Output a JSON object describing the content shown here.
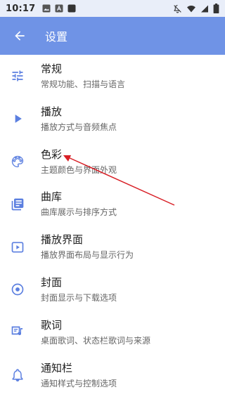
{
  "status_bar": {
    "time": "10:17",
    "notification_icons": [
      "image-icon",
      "text-icon",
      "app-icon"
    ],
    "system_icons": [
      "mute-icon",
      "wifi-icon",
      "signal-icon",
      "battery-icon"
    ]
  },
  "app_bar": {
    "title": "设置",
    "background": "#6f93e6"
  },
  "settings": [
    {
      "title": "常规",
      "subtitle": "常规功能、扫描与语言",
      "icon": "tune-icon"
    },
    {
      "title": "播放",
      "subtitle": "播放方式与音频焦点",
      "icon": "play-icon"
    },
    {
      "title": "色彩",
      "subtitle": "主题颜色与界面外观",
      "icon": "palette-icon"
    },
    {
      "title": "曲库",
      "subtitle": "曲库展示与排序方式",
      "icon": "library-icon"
    },
    {
      "title": "播放界面",
      "subtitle": "播放界面布局与显示行为",
      "icon": "now-playing-icon"
    },
    {
      "title": "封面",
      "subtitle": "封面显示与下载选项",
      "icon": "album-icon"
    },
    {
      "title": "歌词",
      "subtitle": "桌面歌词、状态栏歌词与来源",
      "icon": "lyrics-icon"
    },
    {
      "title": "通知栏",
      "subtitle": "通知样式与控制选项",
      "icon": "notification-icon"
    }
  ],
  "accent_color": "#5b7fe0",
  "annotation_color": "#d81f26"
}
